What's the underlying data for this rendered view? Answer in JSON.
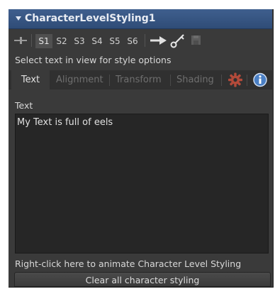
{
  "title": "CharacterLevelStyling1",
  "toolbar": {
    "slots": [
      "S1",
      "S2",
      "S3",
      "S4",
      "S5",
      "S6"
    ],
    "active_slot": "S1"
  },
  "status": "Select text in view for style options",
  "tabs": [
    {
      "label": "Text",
      "active": true
    },
    {
      "label": "Alignment",
      "active": false
    },
    {
      "label": "Transform",
      "active": false
    },
    {
      "label": "Shading",
      "active": false
    }
  ],
  "icons": {
    "collapse": "collapse-triangle-icon",
    "pin": "pin-icon",
    "arrow": "arrow-right-icon",
    "key": "key-icon",
    "save": "disk-icon",
    "settings": "gear-icon",
    "info": "info-icon"
  },
  "text_section": {
    "label": "Text",
    "value": "My Text is full of eels"
  },
  "hint": "Right-click here to animate Character Level Styling",
  "clear_button": "Clear all character styling",
  "colors": {
    "title_bar": "#3f5f8e",
    "panel_bg": "#3a3a3a",
    "field_bg": "#262626",
    "gear": "#b34a3a",
    "info": "#4a7fc4"
  }
}
